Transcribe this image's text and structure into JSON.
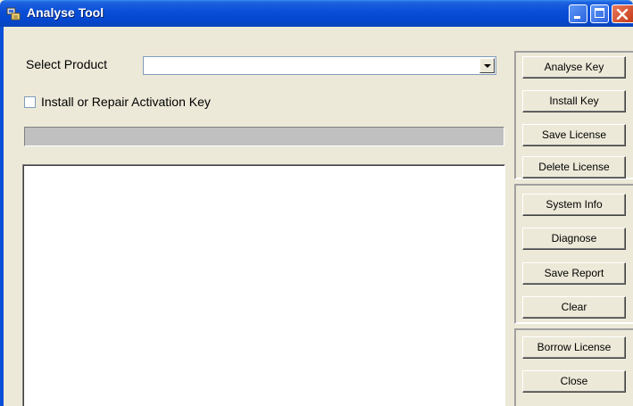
{
  "window": {
    "title": "Analyse Tool",
    "icons": {
      "app": "app-icon",
      "minimize": "minimize-icon",
      "maximize": "maximize-icon",
      "close": "close-icon"
    }
  },
  "form": {
    "select_product_label": "Select Product",
    "product_value": "",
    "install_repair_label": "Install or Repair Activation Key",
    "install_repair_checked": false,
    "progress": 0,
    "output_text": ""
  },
  "buttons": {
    "analyse_key": "Analyse Key",
    "install_key": "Install Key",
    "save_license": "Save License",
    "delete_license": "Delete License",
    "system_info": "System Info",
    "diagnose": "Diagnose",
    "save_report": "Save Report",
    "clear": "Clear",
    "borrow_license": "Borrow License",
    "close": "Close"
  },
  "colors": {
    "titlebar": "#0a4fd8",
    "face": "#ece9d8",
    "close_button": "#c53b18",
    "progress_track": "#c0c0c0"
  }
}
